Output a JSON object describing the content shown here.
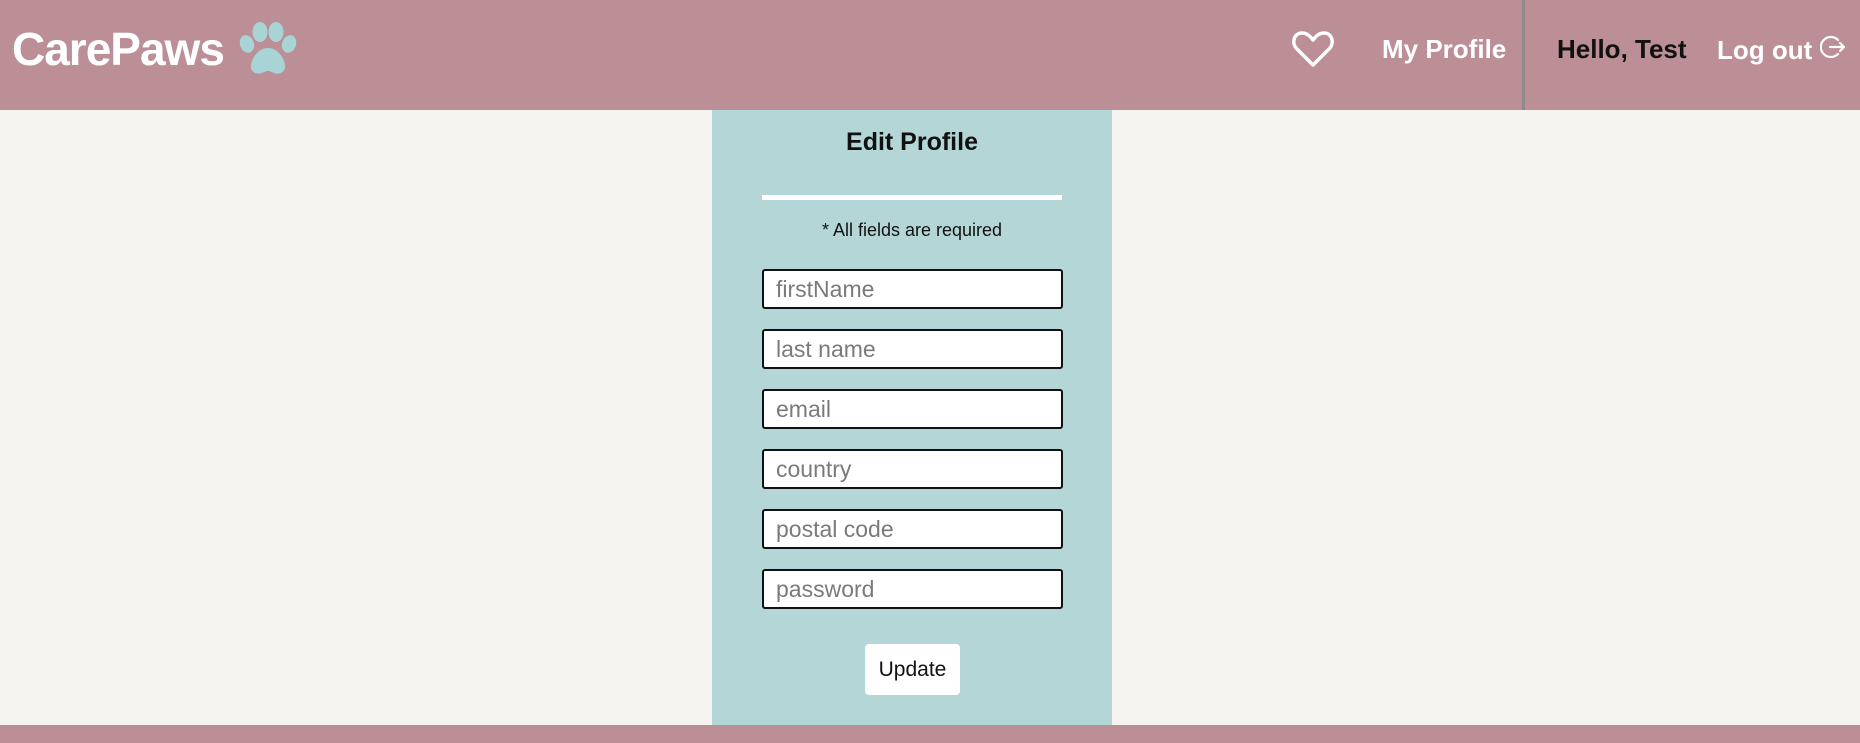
{
  "header": {
    "brand": "CarePaws",
    "brand_icon": "paw-icon",
    "favorites_icon": "heart-icon",
    "my_profile": "My Profile",
    "greeting": "Hello, Test",
    "logout": "Log out",
    "logout_icon": "logout-icon"
  },
  "form": {
    "title": "Edit Profile",
    "required_note": "* All fields are required",
    "fields": [
      {
        "name": "firstName",
        "placeholder": "firstName",
        "value": ""
      },
      {
        "name": "lastName",
        "placeholder": "last name",
        "value": ""
      },
      {
        "name": "email",
        "placeholder": "email",
        "value": ""
      },
      {
        "name": "country",
        "placeholder": "country",
        "value": ""
      },
      {
        "name": "postalCode",
        "placeholder": "postal code",
        "value": ""
      },
      {
        "name": "password",
        "placeholder": "password",
        "value": ""
      }
    ],
    "submit_label": "Update"
  },
  "colors": {
    "header_bg": "#bb8f95",
    "page_bg": "#f6f4f0",
    "panel_bg": "#b4d6d7",
    "paw": "#a8d4d6"
  }
}
